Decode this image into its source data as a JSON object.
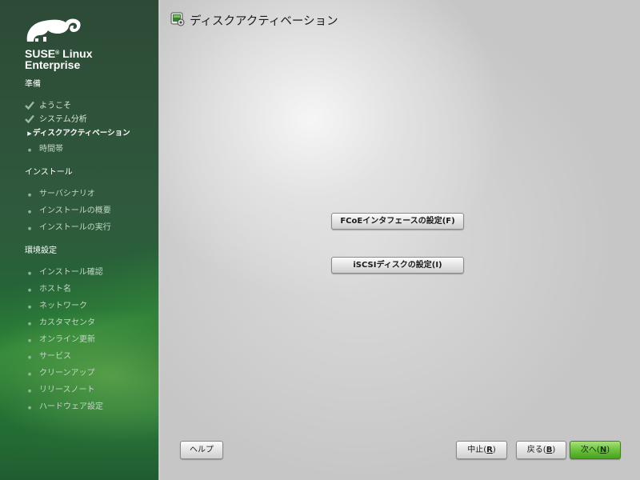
{
  "brand": {
    "line1": "SUSE",
    "reg": "®",
    "line1b": " Linux",
    "line2": "Enterprise"
  },
  "sidebar": {
    "sections": [
      {
        "title": "準備",
        "steps": [
          {
            "label": "ようこそ",
            "state": "done"
          },
          {
            "label": "システム分析",
            "state": "done"
          },
          {
            "label": "ディスクアクティベーション",
            "state": "current"
          },
          {
            "label": "時間帯",
            "state": "future"
          }
        ]
      },
      {
        "title": "インストール",
        "steps": [
          {
            "label": "サーバシナリオ",
            "state": "future"
          },
          {
            "label": "インストールの概要",
            "state": "future"
          },
          {
            "label": "インストールの実行",
            "state": "future"
          }
        ]
      },
      {
        "title": "環境設定",
        "steps": [
          {
            "label": "インストール確認",
            "state": "future"
          },
          {
            "label": "ホスト名",
            "state": "future"
          },
          {
            "label": "ネットワーク",
            "state": "future"
          },
          {
            "label": "カスタマセンタ",
            "state": "future"
          },
          {
            "label": "オンライン更新",
            "state": "future"
          },
          {
            "label": "サービス",
            "state": "future"
          },
          {
            "label": "クリーンアップ",
            "state": "future"
          },
          {
            "label": "リリースノート",
            "state": "future"
          },
          {
            "label": "ハードウェア設定",
            "state": "future"
          }
        ]
      }
    ]
  },
  "main": {
    "title": "ディスクアクティベーション",
    "fcoe_button": "FCoEインタフェースの設定(F)",
    "iscsi_button": "iSCSIディスクの設定(I)"
  },
  "footer": {
    "help": "ヘルプ",
    "abort": {
      "text": "中止(",
      "key": "R",
      "end": ")"
    },
    "back": {
      "text": "戻る(",
      "key": "B",
      "end": ")"
    },
    "next": {
      "text": "次へ(",
      "key": "N",
      "end": ")"
    }
  },
  "colors": {
    "sidebar": "#2f5a3d",
    "accent": "#6cc23c"
  }
}
